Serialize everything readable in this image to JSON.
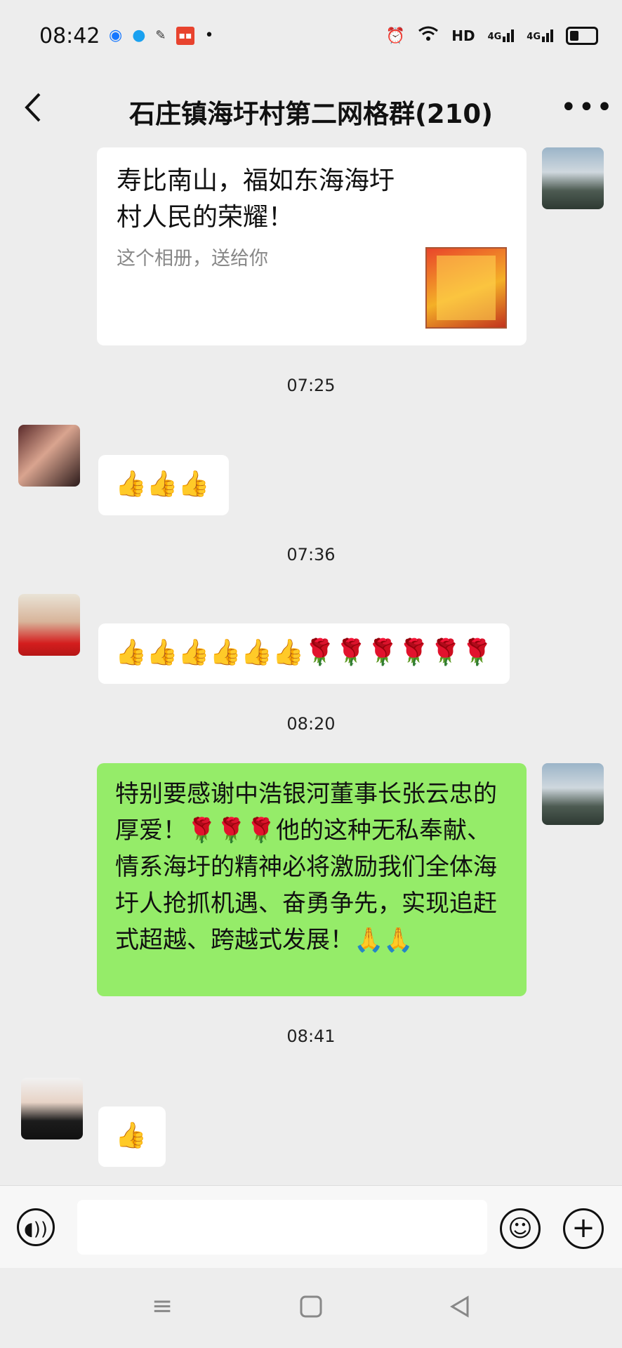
{
  "status_bar": {
    "time": "08:42",
    "left_icons": [
      "blue-circle-icon",
      "penguin-icon",
      "xuexi-icon",
      "toutiao-icon",
      "dot-icon"
    ],
    "right_icons": [
      "alarm-icon",
      "wifi-icon",
      "hd-signal-icon",
      "4g-signal-icon",
      "4g-signal-icon",
      "battery-icon"
    ],
    "hd_label": "HD",
    "net1_label": "4G",
    "net2_label": "4G",
    "battery_level": 0.35
  },
  "header": {
    "title": "石庄镇海圩村第二网格群(210)",
    "back_icon": "chevron-left-icon",
    "more_icon": "more-icon"
  },
  "messages": [
    {
      "type": "album",
      "side": "right",
      "title": "寿比南山，福如东海海圩村人民的荣耀！",
      "subtitle": "这个相册，送给你"
    },
    {
      "type": "time",
      "text": "07:25"
    },
    {
      "type": "emoji",
      "side": "left",
      "nickname": "",
      "content": "👍👍👍"
    },
    {
      "type": "time",
      "text": "07:36"
    },
    {
      "type": "emoji",
      "side": "left",
      "nickname": "",
      "content": "👍👍👍👍👍👍🌹🌹🌹🌹🌹🌹"
    },
    {
      "type": "time",
      "text": "08:20"
    },
    {
      "type": "text",
      "side": "right",
      "content": "特别要感谢中浩银河董事长张云忠的厚爱！🌹🌹🌹他的这种无私奉献、情系海圩的精神必将激励我们全体海圩人抢抓机遇、奋勇争先，实现追赶式超越、跨越式发展！🙏🙏"
    },
    {
      "type": "time",
      "text": "08:41"
    },
    {
      "type": "emoji",
      "side": "left",
      "nickname": "",
      "content": "👍"
    }
  ],
  "input_bar": {
    "voice_icon": "voice-icon",
    "emoji_icon": "emoji-icon",
    "plus_icon": "plus-icon",
    "placeholder": ""
  },
  "nav_bar": {
    "menu_icon": "menu-icon",
    "home_icon": "home-square-icon",
    "back_icon": "back-triangle-icon"
  },
  "colors": {
    "background": "#ededed",
    "bubble_self": "#95ec69",
    "bubble_other": "#ffffff",
    "text": "#111111",
    "secondary_text": "#888888"
  }
}
